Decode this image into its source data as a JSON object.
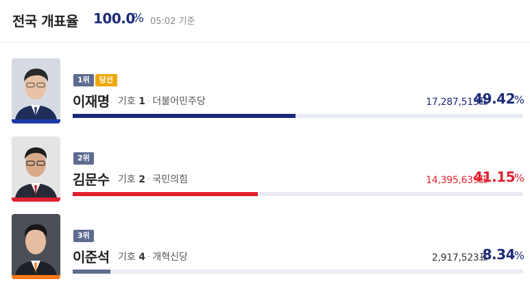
{
  "header": {
    "title": "전국 개표율",
    "rate": "100.0",
    "pct_sign": "%",
    "time": "05:02 기준"
  },
  "candidates": [
    {
      "rank": "1위",
      "status": "당선",
      "name": "이재명",
      "number_label": "기호",
      "number": "1",
      "party": "더불어민주당",
      "votes": "17,287,513표",
      "percent": "49.42",
      "pct_sign": "%",
      "share": 49.42,
      "color": "#1b2a78"
    },
    {
      "rank": "2위",
      "name": "김문수",
      "number_label": "기호",
      "number": "2",
      "party": "국민의힘",
      "votes": "14,395,639표",
      "percent": "41.15",
      "pct_sign": "%",
      "share": 41.15,
      "color": "#e0202f"
    },
    {
      "rank": "3위",
      "name": "이준석",
      "number_label": "기호",
      "number": "4",
      "party": "개혁신당",
      "votes": "2,917,523표",
      "percent": "8.34",
      "pct_sign": "%",
      "share": 8.34,
      "color": "#5d6b8f"
    }
  ]
}
